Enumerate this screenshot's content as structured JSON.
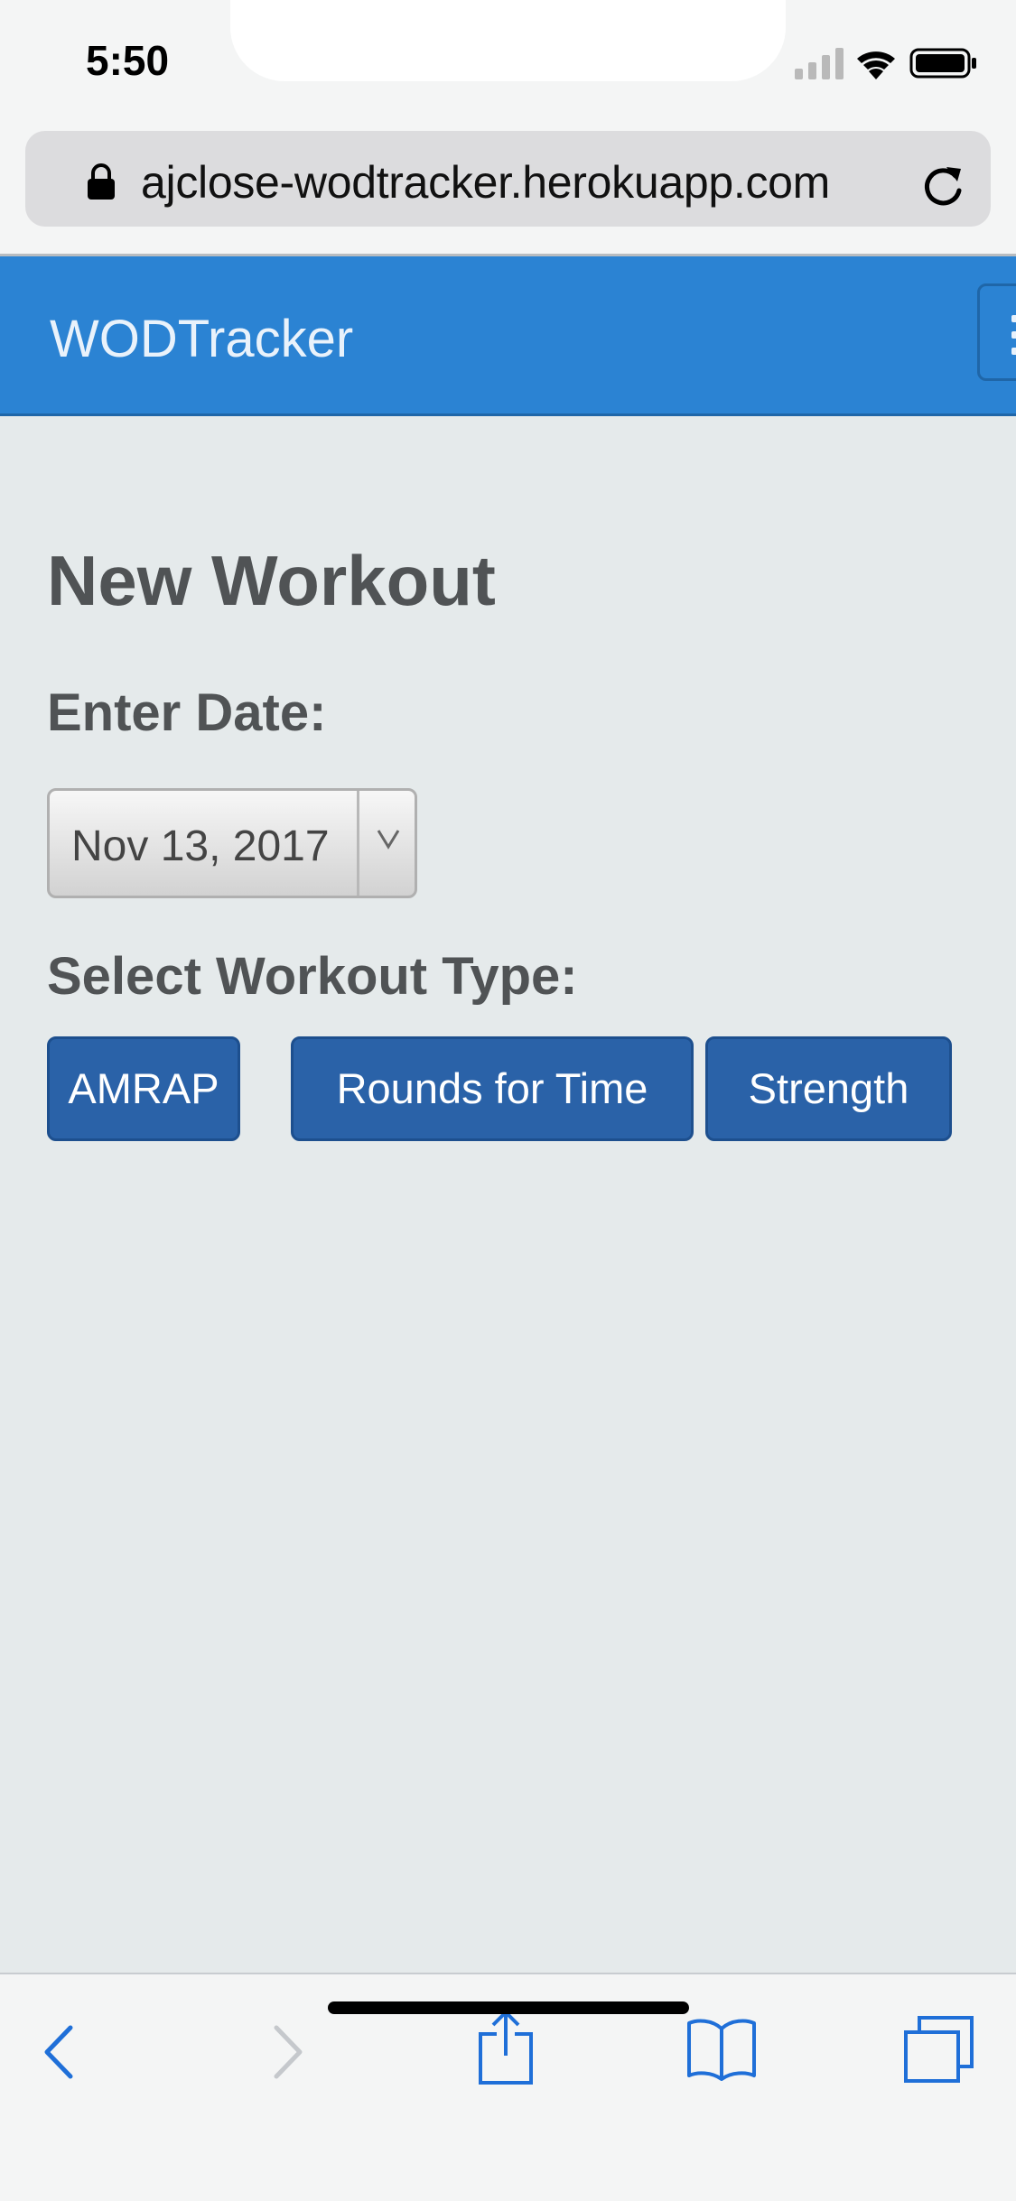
{
  "status_bar": {
    "time": "5:50"
  },
  "browser": {
    "url": "ajclose-wodtracker.herokuapp.com"
  },
  "navbar": {
    "brand": "WODTracker"
  },
  "page": {
    "title": "New Workout",
    "date_label": "Enter Date:",
    "date_value": "Nov 13, 2017",
    "type_label": "Select Workout Type:",
    "workout_types": [
      "AMRAP",
      "Rounds for Time",
      "Strength"
    ]
  },
  "colors": {
    "navbar": "#2b83d3",
    "button": "#2a62a8",
    "background": "#e5eaeb",
    "safari_blue": "#1f6fd8"
  },
  "toolbar": {
    "icons": [
      "back-icon",
      "forward-icon",
      "share-icon",
      "bookmarks-icon",
      "tabs-icon"
    ]
  }
}
